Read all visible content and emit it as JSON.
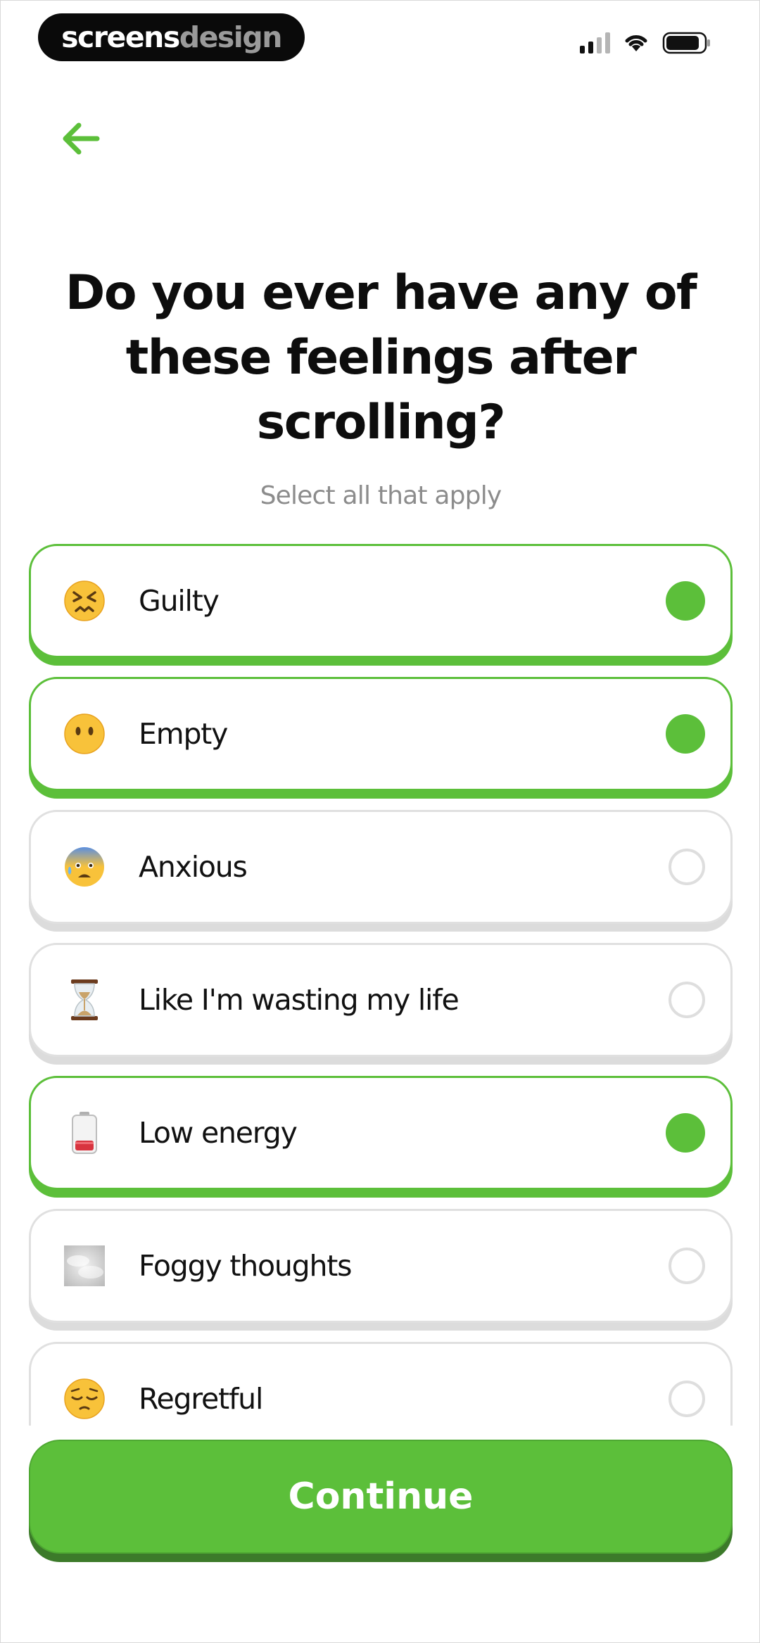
{
  "status_bar": {
    "brand_part1": "screens",
    "brand_part2": "design",
    "icons": [
      "signal-icon",
      "wifi-icon",
      "battery-icon"
    ]
  },
  "nav": {
    "back_icon": "arrow-left-icon"
  },
  "question": {
    "title": "Do you ever have any of these feelings after scrolling?",
    "subtitle": "Select all that apply"
  },
  "options": [
    {
      "label": "Guilty",
      "icon": "confounded-face-icon",
      "selected": true
    },
    {
      "label": "Empty",
      "icon": "face-without-mouth-icon",
      "selected": true
    },
    {
      "label": "Anxious",
      "icon": "anxious-face-with-sweat-icon",
      "selected": false
    },
    {
      "label": "Like I'm wasting my life",
      "icon": "hourglass-icon",
      "selected": false
    },
    {
      "label": "Low energy",
      "icon": "low-battery-icon",
      "selected": true
    },
    {
      "label": "Foggy thoughts",
      "icon": "fog-icon",
      "selected": false
    },
    {
      "label": "Regretful",
      "icon": "pensive-face-icon",
      "selected": false
    }
  ],
  "continue_button": {
    "label": "Continue"
  },
  "colors": {
    "accent": "#5cbf3a",
    "accent_shadow": "#3c7a2a",
    "text": "#111111",
    "muted": "#8c8c8c",
    "border": "#e0e0e0"
  }
}
